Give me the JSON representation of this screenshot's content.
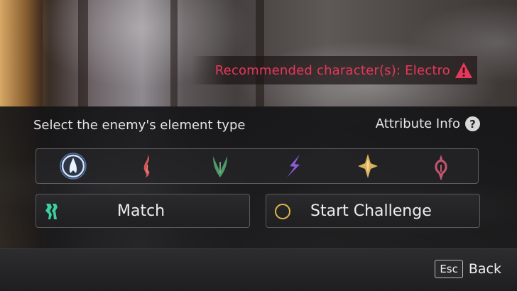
{
  "recommendation": {
    "text": "Recommended character(s): Electro",
    "icon": "warning-triangle-icon",
    "color": "#e8375a"
  },
  "selector": {
    "prompt": "Select the enemy's element type",
    "attribute_info_label": "Attribute Info",
    "help_icon_text": "?",
    "elements": [
      {
        "name": "hydro",
        "icon": "hydro-icon",
        "color": "#6ea8ff",
        "selected": true
      },
      {
        "name": "pyro",
        "icon": "pyro-icon",
        "color": "#d2565a",
        "selected": false
      },
      {
        "name": "dendro",
        "icon": "dendro-icon",
        "color": "#4e9a68",
        "selected": false
      },
      {
        "name": "electro",
        "icon": "electro-icon",
        "color": "#8a5bd6",
        "selected": false
      },
      {
        "name": "geo",
        "icon": "geo-icon",
        "color": "#d9b15a",
        "selected": false
      },
      {
        "name": "cryo",
        "icon": "cryo-icon",
        "color": "#c0566e",
        "selected": false
      }
    ]
  },
  "actions": {
    "match_label": "Match",
    "start_label": "Start Challenge",
    "match_icon_color": "#3bd0a0",
    "start_icon_color": "#e0b64b"
  },
  "footer": {
    "esc_key": "Esc",
    "back_label": "Back"
  }
}
